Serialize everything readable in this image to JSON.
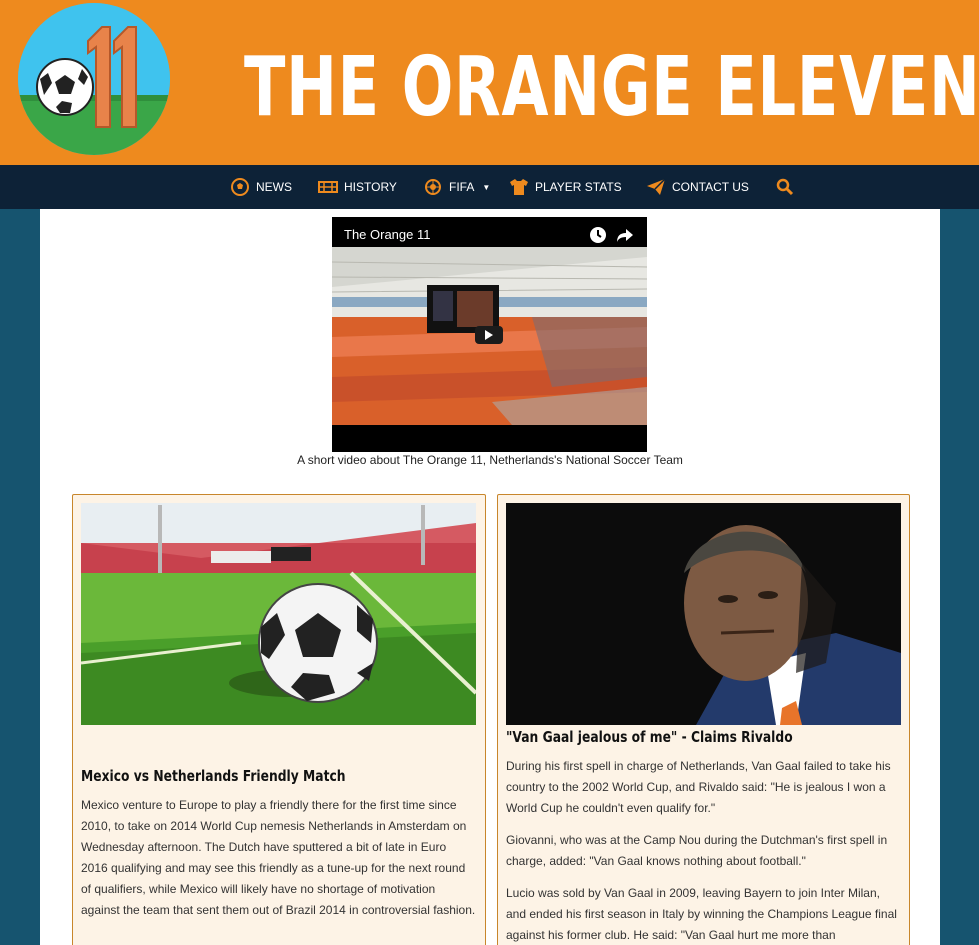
{
  "header": {
    "site_title": "THE ORANGE ELEVEN",
    "logo_text": "11",
    "brand_color": "#ee8a1e"
  },
  "nav": {
    "items": [
      {
        "label": "NEWS",
        "icon": "soccer-ball-icon"
      },
      {
        "label": "HISTORY",
        "icon": "stadium-icon"
      },
      {
        "label": "FIFA",
        "icon": "globe-ball-icon",
        "dropdown": true
      },
      {
        "label": "PLAYER STATS",
        "icon": "jersey-icon"
      },
      {
        "label": "CONTACT US",
        "icon": "paper-plane-icon"
      }
    ],
    "search_icon": "search-icon"
  },
  "video": {
    "title": "The Orange 11",
    "caption": "A short video about The Orange 11, Netherlands's National Soccer Team"
  },
  "articles": [
    {
      "title": "Mexico vs Netherlands Friendly Match",
      "paragraphs": [
        "Mexico venture to Europe to play a friendly there for the first time since 2010, to take on 2014 World Cup nemesis Netherlands in Amsterdam on Wednesday afternoon. The Dutch have sputtered a bit of late in Euro 2016 qualifying and may see this friendly as a tune-up for the next round of qualifiers, while Mexico will likely have no shortage of motivation against the team that sent them out of Brazil 2014 in controversial fashion."
      ]
    },
    {
      "title": "\"Van Gaal jealous of me\" - Claims Rivaldo",
      "paragraphs": [
        "During his first spell in charge of Netherlands, Van Gaal failed to take his country to the 2002 World Cup, and Rivaldo said: \"He is jealous I won a World Cup he couldn't even qualify for.\"",
        "Giovanni, who was at the Camp Nou during the Dutchman's first spell in charge, added: \"Van Gaal knows nothing about football.\"",
        "Lucio was sold by Van Gaal in 2009, leaving Bayern to join Inter Milan, and ended his first season in Italy by winning the Champions League final against his former club. He said: \"Van Gaal hurt me more than"
      ]
    }
  ]
}
